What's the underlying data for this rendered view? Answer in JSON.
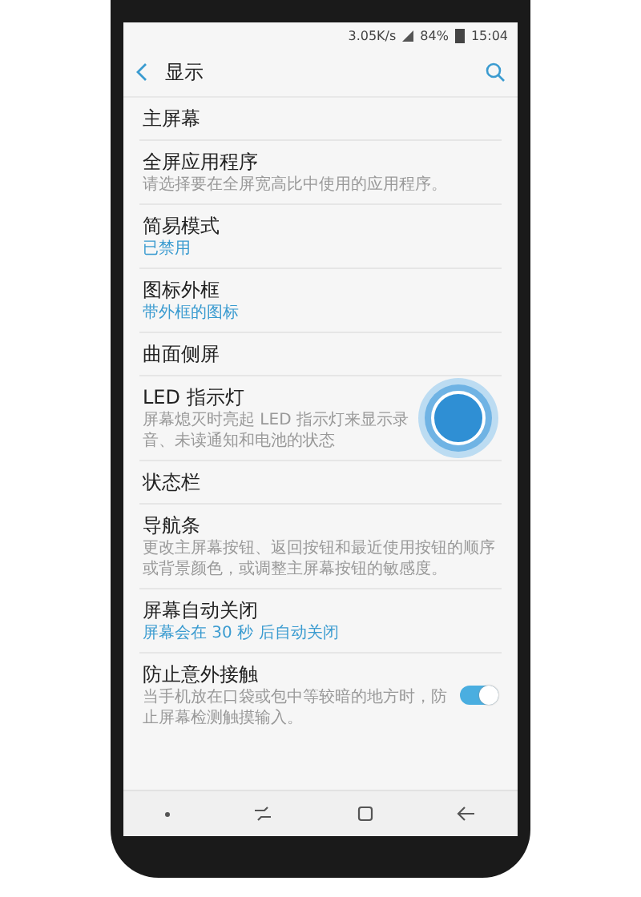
{
  "status_bar": {
    "speed": "3.05K/s",
    "battery": "84%",
    "time": "15:04"
  },
  "header": {
    "title": "显示"
  },
  "items": [
    {
      "title": "主屏幕"
    },
    {
      "title": "全屏应用程序",
      "sub": {
        "text": "请选择要在全屏宽高比中使用的应用程序。",
        "kind": "description"
      }
    },
    {
      "title": "简易模式",
      "sub": {
        "text": "已禁用",
        "kind": "status"
      }
    },
    {
      "title": "图标外框",
      "sub": {
        "text": "带外框的图标",
        "kind": "status"
      }
    },
    {
      "title": "曲面侧屏"
    },
    {
      "title": "LED 指示灯",
      "sub": {
        "text": "屏幕熄灭时亮起 LED 指示灯来显示录音、未读通知和电池的状态",
        "kind": "description"
      },
      "touch": true
    },
    {
      "title": "状态栏"
    },
    {
      "title": "导航条",
      "sub": {
        "text": "更改主屏幕按钮、返回按钮和最近使用按钮的顺序或背景颜色，或调整主屏幕按钮的敏感度。",
        "kind": "description"
      }
    },
    {
      "title": "屏幕自动关闭",
      "sub": {
        "text": "屏幕会在 30 秒 后自动关闭",
        "kind": "status"
      }
    },
    {
      "title": "防止意外接触",
      "sub": {
        "text": "当手机放在口袋或包中等较暗的地方时，防止屏幕检测触摸输入。",
        "kind": "description"
      },
      "toggle": {
        "on": true
      }
    }
  ]
}
